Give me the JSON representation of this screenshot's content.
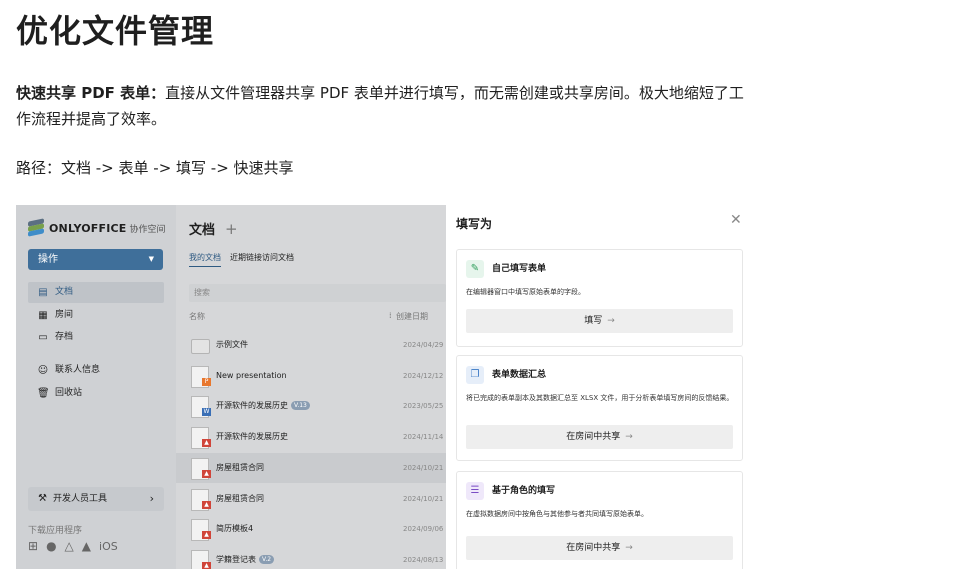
{
  "article": {
    "heading": "优化文件管理",
    "feature_label": "快速共享 PDF 表单：",
    "feature_text": "直接从文件管理器共享 PDF 表单并进行填写，而无需创建或共享房间。极大地缩短了工作流程并提高了效率。",
    "path": "路径：文档 -> 表单 -> 填写 -> 快速共享"
  },
  "app": {
    "brand": "ONLYOFFICE",
    "brand_sub": "协作空间",
    "action_button": "操作",
    "nav": [
      {
        "label": "文档",
        "icon": "document-icon",
        "glyph": "▤",
        "active": true
      },
      {
        "label": "房间",
        "icon": "rooms-icon",
        "glyph": "▦",
        "active": false
      },
      {
        "label": "存档",
        "icon": "archive-icon",
        "glyph": "▭",
        "active": false
      },
      {
        "label": "联系人信息",
        "icon": "contacts-icon",
        "glyph": "☺",
        "active": false
      },
      {
        "label": "回收站",
        "icon": "trash-icon",
        "glyph": "🗑",
        "active": false
      }
    ],
    "dev_tools": "开发人员工具",
    "download_apps": "下载应用程序",
    "os_ios": "iOS"
  },
  "docs": {
    "title": "文档",
    "tabs": [
      "我的文档",
      "近期链接访问文档"
    ],
    "search_placeholder": "搜索",
    "col_name": "名称",
    "col_created": "创建日期",
    "rows": [
      {
        "name": "示例文件",
        "type": "folder",
        "date": "2024/04/29",
        "badge": ""
      },
      {
        "name": "New presentation",
        "type": "pptx",
        "date": "2024/12/12",
        "badge": ""
      },
      {
        "name": "开源软件的发展历史",
        "type": "docx",
        "date": "2023/05/25",
        "badge": "V.13"
      },
      {
        "name": "开源软件的发展历史",
        "type": "pdf",
        "date": "2024/11/14",
        "badge": ""
      },
      {
        "name": "房屋租赁合同",
        "type": "pdf",
        "date": "2024/10/21",
        "badge": "",
        "highlight": true
      },
      {
        "name": "房屋租赁合同",
        "type": "pdf",
        "date": "2024/10/21",
        "badge": ""
      },
      {
        "name": "简历模板4",
        "type": "pdf",
        "date": "2024/09/06",
        "badge": ""
      },
      {
        "name": "学籍登记表",
        "type": "pdf",
        "date": "2024/08/13",
        "badge": "V.2"
      }
    ]
  },
  "panel": {
    "title": "填写为",
    "cards": [
      {
        "title": "自己填写表单",
        "desc": "在编辑器窗口中填写原始表单的字段。",
        "button": "填写",
        "icon": "pencil-icon",
        "glyph": "✎",
        "icon_color": "#2e9e5b",
        "icon_bg": "#e6f5ec"
      },
      {
        "title": "表单数据汇总",
        "desc": "将已完成的表单副本及其数据汇总至 XLSX 文件，用于分析表单填写房间的反馈结果。",
        "button": "在房间中共享",
        "icon": "copy-icon",
        "glyph": "❐",
        "icon_color": "#3a78c4",
        "icon_bg": "#e6eef9"
      },
      {
        "title": "基于角色的填写",
        "desc": "在虚拟数据房间中按角色与其他参与者共同填写原始表单。",
        "button": "在房间中共享",
        "icon": "list-icon",
        "glyph": "☰",
        "icon_color": "#7a4cc4",
        "icon_bg": "#efe8fa"
      }
    ]
  }
}
